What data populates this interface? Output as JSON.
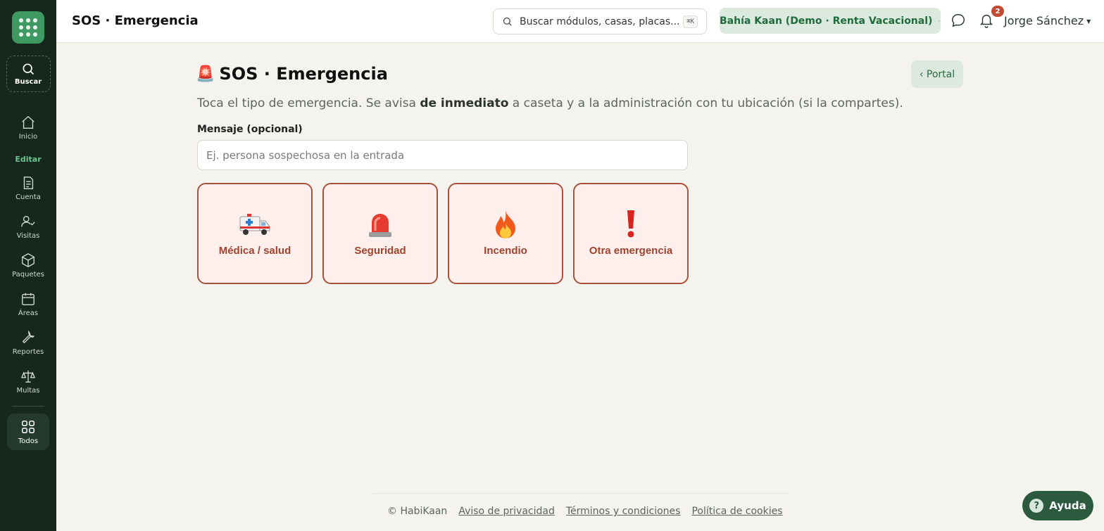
{
  "sidebar": {
    "search_label": "Buscar",
    "items": [
      {
        "label": "Inicio",
        "icon": "home-icon"
      },
      {
        "label": "Editar",
        "icon": ""
      },
      {
        "label": "Cuenta",
        "icon": "receipt-icon"
      },
      {
        "label": "Visitas",
        "icon": "user-check-icon"
      },
      {
        "label": "Paquetes",
        "icon": "package-icon"
      },
      {
        "label": "Áreas",
        "icon": "calendar-icon"
      },
      {
        "label": "Reportes",
        "icon": "wrench-icon"
      },
      {
        "label": "Multas",
        "icon": "scale-icon"
      }
    ],
    "todos_label": "Todos"
  },
  "header": {
    "title": "SOS · Emergencia",
    "search_placeholder": "Buscar módulos, casas, placas...",
    "search_shortcut": "⌘K",
    "property": "Bahía Kaan (Demo · Renta Vacacional)",
    "notifications_count": "2",
    "user_name": "Jorge Sánchez"
  },
  "main": {
    "title_icon": "🚨",
    "title": "SOS · Emergencia",
    "portal_label": "‹ Portal",
    "desc_before": "Toca el tipo de emergencia. Se avisa ",
    "desc_bold": "de inmediato",
    "desc_after": " a caseta y a la administración con tu ubicación (si la compartes).",
    "message_label": "Mensaje (opcional)",
    "message_placeholder": "Ej. persona sospechosa en la entrada",
    "message_value": "",
    "cards": [
      {
        "emoji": "🚑",
        "label": "Médica / salud"
      },
      {
        "emoji": "🚨",
        "label": "Seguridad"
      },
      {
        "emoji": "🔥",
        "label": "Incendio"
      },
      {
        "emoji": "❗",
        "label": "Otra emergencia"
      }
    ]
  },
  "footer": {
    "copyright": "© HabiKaan",
    "privacy": "Aviso de privacidad",
    "terms": "Términos y condiciones",
    "cookies": "Política de cookies"
  },
  "help_label": "Ayuda",
  "colors": {
    "sidebar_bg": "#16271c",
    "accent": "#3e9a62",
    "emergency": "#a8523c",
    "card_bg": "#fcefec"
  }
}
